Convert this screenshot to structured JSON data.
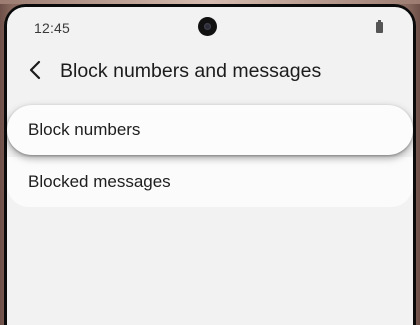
{
  "status_bar": {
    "time": "12:45",
    "icons": [
      "front-camera",
      "battery-icon"
    ]
  },
  "app_bar": {
    "back_icon": "chevron-left-icon",
    "title": "Block numbers and messages"
  },
  "menu": {
    "items": [
      {
        "label": "Block numbers"
      },
      {
        "label": "Blocked messages"
      }
    ]
  },
  "colors": {
    "screen_background": "#f2f2f2",
    "card_background": "#fbfbfb",
    "text_primary": "#1e1e1e",
    "device_frame": "#b79a8f"
  }
}
